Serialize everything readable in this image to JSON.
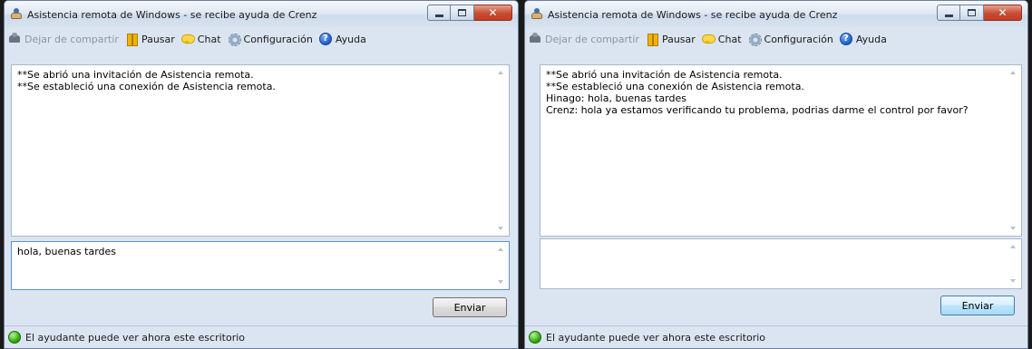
{
  "windows": [
    {
      "title": "Asistencia remota de Windows - se recibe ayuda de Crenz",
      "toolbar": {
        "share": "Dejar de compartir",
        "pause": "Pausar",
        "chat": "Chat",
        "settings": "Configuración",
        "help": "Ayuda"
      },
      "chat_log": [
        "**Se abrió una invitación de Asistencia remota.",
        "**Se estableció una conexión de Asistencia remota."
      ],
      "message_input": "hola, buenas tardes",
      "send_label": "Enviar",
      "status": "El ayudante puede ver ahora este escritorio"
    },
    {
      "title": "Asistencia remota de Windows - se recibe ayuda de Crenz",
      "toolbar": {
        "share": "Dejar de compartir",
        "pause": "Pausar",
        "chat": "Chat",
        "settings": "Configuración",
        "help": "Ayuda"
      },
      "chat_log": [
        "**Se abrió una invitación de Asistencia remota.",
        "**Se estableció una conexión de Asistencia remota.",
        "Hinago: hola, buenas tardes",
        "Crenz: hola ya estamos verificando tu problema, podrias darme el control por favor?"
      ],
      "message_input": "",
      "send_label": "Enviar",
      "status": "El ayudante puede ver ahora este escritorio"
    }
  ],
  "icons": {
    "title": "remote-assistance-icon",
    "share": "stop-sharing-icon",
    "pause": "pause-icon",
    "chat": "chat-bubble-icon",
    "settings": "gear-icon",
    "help": "help-icon",
    "status": "green-status-icon"
  },
  "colors": {
    "window_bg": "#dbe5f1",
    "close_button": "#c74b32",
    "status_green": "#2da70c"
  }
}
